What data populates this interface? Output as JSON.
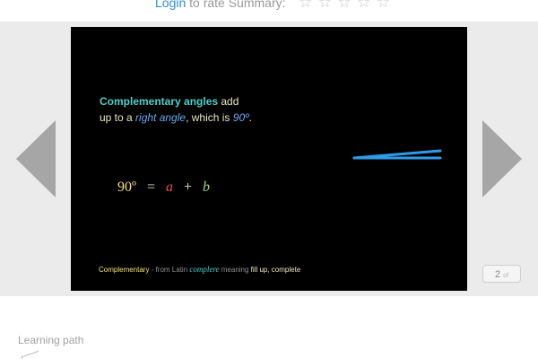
{
  "rating": {
    "login_label": "Login",
    "rate_text": " to rate Summary:",
    "star_glyph": "☆",
    "star_count": 5
  },
  "navigation": {
    "prev_icon": "triangle-left-icon",
    "next_icon": "triangle-right-icon"
  },
  "slide": {
    "term": "Complementary angles",
    "text_1": " add up to a ",
    "right_angle": "right angle",
    "text_2": ", which is ",
    "ninety": "90º",
    "text_3": ".",
    "equation": {
      "lhs": "90º",
      "equals": "=",
      "a": "a",
      "plus": "+",
      "b": "b"
    },
    "footnote": {
      "term": "Complementary",
      "from": " - from Latin ",
      "latin": "complere",
      "meaning_word": " meaning ",
      "meaning": "fill up, complete"
    },
    "angle_color": "#2f9be8"
  },
  "pager": {
    "current": "2",
    "of_label": "of"
  },
  "learning_path": {
    "label": "Learning path"
  }
}
